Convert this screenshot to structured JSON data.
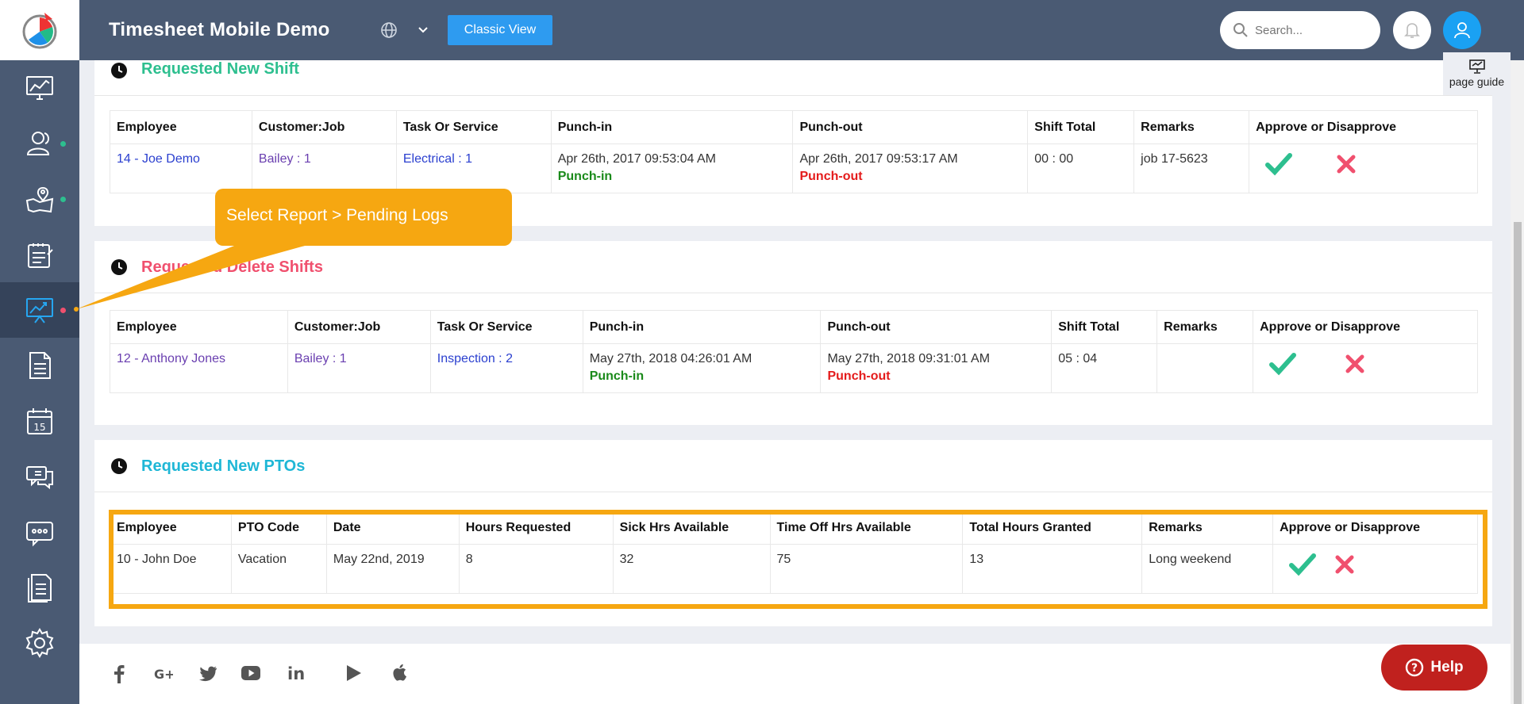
{
  "header": {
    "title": "Timesheet Mobile Demo",
    "classic_view_label": "Classic View",
    "search_placeholder": "Search..."
  },
  "page_guide": {
    "label": "page guide"
  },
  "sidebar": {
    "items": [
      {
        "icon": "dashboard-icon",
        "dot": false
      },
      {
        "icon": "users-icon",
        "dot": true,
        "dot_color": "#2dbf8f"
      },
      {
        "icon": "map-location-icon",
        "dot": true,
        "dot_color": "#2dbf8f"
      },
      {
        "icon": "clipboard-icon",
        "dot": false
      },
      {
        "icon": "reports-icon",
        "dot": true,
        "dot_color": "#f0506e",
        "active": true
      },
      {
        "icon": "document-icon",
        "dot": false
      },
      {
        "icon": "calendar-icon",
        "dot": false,
        "calendar_day": "15"
      },
      {
        "icon": "chat-icon",
        "dot": false
      },
      {
        "icon": "messages-icon",
        "dot": false
      },
      {
        "icon": "forms-icon",
        "dot": false
      },
      {
        "icon": "settings-icon",
        "dot": false
      }
    ]
  },
  "callout": {
    "text": "Select Report > Pending Logs"
  },
  "new_shift": {
    "title": "Requested New Shift",
    "title_color": "#2dbf8f",
    "columns": [
      "Employee",
      "Customer:Job",
      "Task Or Service",
      "Punch-in",
      "Punch-out",
      "Shift Total",
      "Remarks",
      "Approve or Disapprove"
    ],
    "rows": [
      {
        "employee": "14 - Joe Demo",
        "customer_job": "Bailey : 1",
        "task": "Electrical : 1",
        "punch_in": "Apr 26th, 2017 09:53:04 AM",
        "punch_in_tag": "Punch-in",
        "punch_out": "Apr 26th, 2017 09:53:17 AM",
        "punch_out_tag": "Punch-out",
        "shift_total": "00 : 00",
        "remarks": "job 17-5623"
      }
    ]
  },
  "delete_shifts": {
    "title": "Requested Delete Shifts",
    "title_color": "#f0506e",
    "columns": [
      "Employee",
      "Customer:Job",
      "Task Or Service",
      "Punch-in",
      "Punch-out",
      "Shift Total",
      "Remarks",
      "Approve or Disapprove"
    ],
    "rows": [
      {
        "employee": "12 - Anthony Jones",
        "customer_job": "Bailey : 1",
        "task": "Inspection : 2",
        "punch_in": "May 27th, 2018 04:26:01 AM",
        "punch_in_tag": "Punch-in",
        "punch_out": "May 27th, 2018 09:31:01 AM",
        "punch_out_tag": "Punch-out",
        "shift_total": "05 : 04",
        "remarks": ""
      }
    ]
  },
  "new_ptos": {
    "title": "Requested New PTOs",
    "title_color": "#1fb7d6",
    "columns": [
      "Employee",
      "PTO Code",
      "Date",
      "Hours Requested",
      "Sick Hrs Available",
      "Time Off Hrs Available",
      "Total Hours Granted",
      "Remarks",
      "Approve or Disapprove"
    ],
    "rows": [
      {
        "employee": "10 - John Doe",
        "pto_code": "Vacation",
        "date": "May 22nd, 2019",
        "hours_requested": "8",
        "sick_hrs": "32",
        "time_off_hrs": "75",
        "total_granted": "13",
        "remarks": "Long weekend"
      }
    ]
  },
  "footer": {
    "social": [
      "facebook-icon",
      "google-plus-icon",
      "twitter-icon",
      "youtube-icon",
      "linkedin-icon",
      "google-play-icon",
      "apple-icon"
    ]
  },
  "help_button": {
    "label": "Help"
  },
  "colors": {
    "sidebar_bg": "#4a5a73",
    "accent_blue": "#2e9bf0",
    "highlight_orange": "#f6a711",
    "approve_green": "#2dbf8f",
    "disapprove_red": "#f0506e",
    "help_red": "#c0211e"
  }
}
